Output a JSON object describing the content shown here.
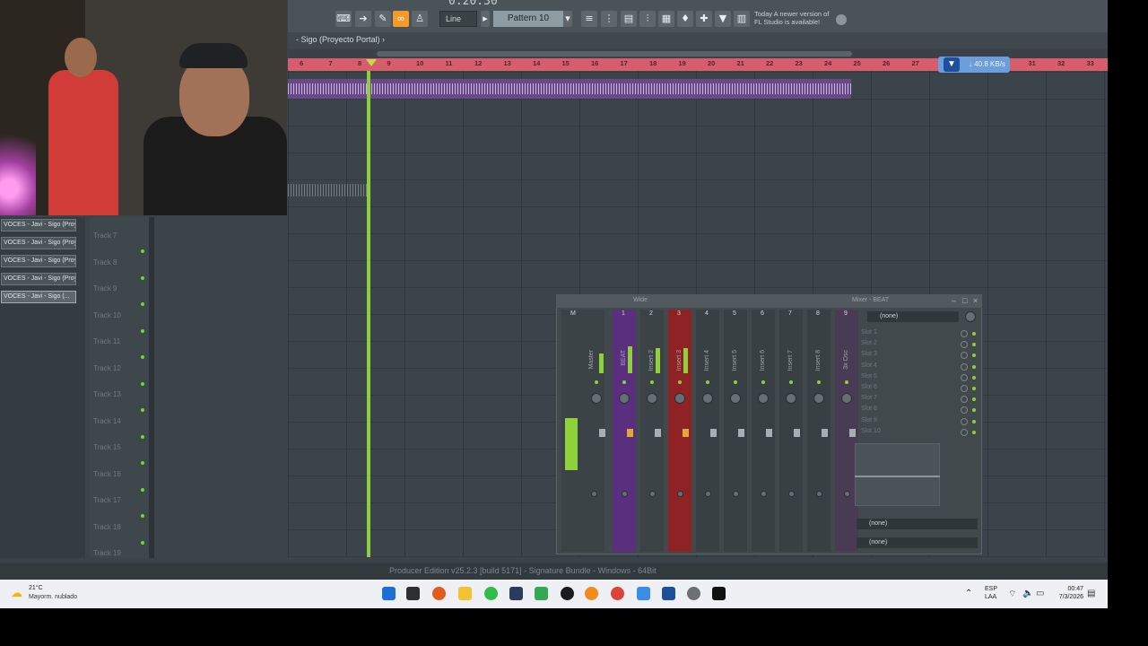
{
  "toolbar": {
    "time": "0:20:30",
    "snap": "Line",
    "pattern": "Pattern 10",
    "news_line1": "Today  A newer version of",
    "news_line2": "FL Studio is available!"
  },
  "playlist": {
    "breadcrumb": "- Sigo (Proyecto Portal) ›",
    "ruler_numbers": [
      "6",
      "7",
      "8",
      "9",
      "10",
      "11",
      "12",
      "13",
      "14",
      "15",
      "16",
      "17",
      "18",
      "19",
      "20",
      "21",
      "22",
      "23",
      "24",
      "25",
      "26",
      "27",
      "28",
      "29",
      "30",
      "31",
      "32",
      "33"
    ],
    "channels": [
      "VOCES - Javi - Sigo (Proy...",
      "VOCES - Javi - Sigo (Proy...",
      "VOCES - Javi - Sigo (Proy...",
      "VOCES - Javi - Sigo (Proy...",
      "VOCES - Javi - Sigo (..."
    ],
    "tracks": [
      "Track 7",
      "Track 8",
      "Track 9",
      "Track 10",
      "Track 11",
      "Track 12",
      "Track 13",
      "Track 14",
      "Track 15",
      "Track 16",
      "Track 17",
      "Track 18",
      "Track 19"
    ]
  },
  "download_speed": "↓ 40.8 KB/s",
  "mixer": {
    "mode": "Wide",
    "title": "Mixer - BEAT",
    "strips": [
      {
        "num": "M",
        "name": "Master"
      },
      {
        "num": "1",
        "name": "BEAT"
      },
      {
        "num": "2",
        "name": "Insert 2"
      },
      {
        "num": "3",
        "name": "Insert 3"
      },
      {
        "num": "4",
        "name": "Insert 4"
      },
      {
        "num": "5",
        "name": "Insert 5"
      },
      {
        "num": "6",
        "name": "Insert 6"
      },
      {
        "num": "7",
        "name": "Insert 7"
      },
      {
        "num": "8",
        "name": "Insert 8"
      },
      {
        "num": "9",
        "name": "3x Osc"
      }
    ],
    "preset": "(none)",
    "slots": [
      "Slot 1",
      "Slot 2",
      "Slot 3",
      "Slot 4",
      "Slot 5",
      "Slot 6",
      "Slot 7",
      "Slot 8",
      "Slot 9",
      "Slot 10"
    ],
    "send_1": "(none)",
    "send_2": "(none)"
  },
  "status": "Producer Edition v25.2.3 [build 5171] - Signature Bundle - Windows - 64Bit",
  "taskbar": {
    "temp": "21°C",
    "weather": "Mayorm. nublado",
    "lang_1": "ESP",
    "lang_2": "LAA",
    "time": "00:47",
    "date": "7/3/2026"
  }
}
